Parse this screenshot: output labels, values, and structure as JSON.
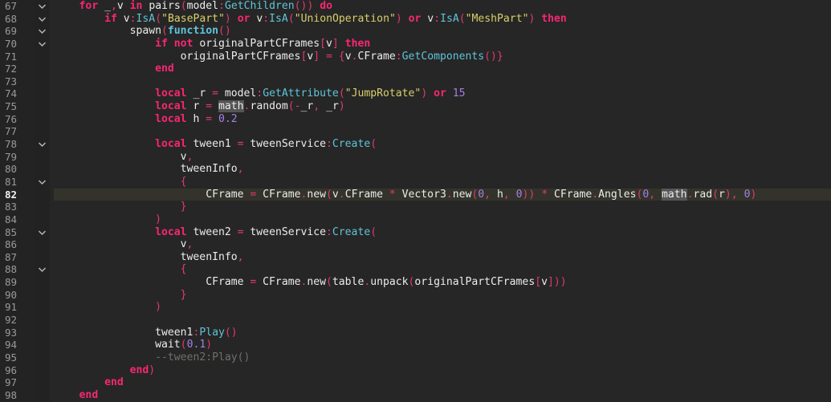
{
  "editor": {
    "current_line": 82,
    "colors": {
      "background": "#262626",
      "keyword": "#f92672",
      "method": "#5fc4da",
      "string": "#d8cf6a",
      "number": "#a77ee6",
      "comment": "#6f6f6a"
    },
    "fold_icon": "chevron-down-icon",
    "lines": [
      {
        "n": "67",
        "fold": true,
        "tokens": [
          [
            "t",
            "    "
          ],
          [
            "k",
            "for"
          ],
          [
            "t",
            " _"
          ],
          [
            "p",
            ","
          ],
          [
            "t",
            "v "
          ],
          [
            "k",
            "in"
          ],
          [
            "t",
            " pairs"
          ],
          [
            "p",
            "("
          ],
          [
            "t",
            "model"
          ],
          [
            "p",
            ":"
          ],
          [
            "f",
            "GetChildren"
          ],
          [
            "p",
            "())"
          ],
          [
            "t",
            " "
          ],
          [
            "k",
            "do"
          ]
        ]
      },
      {
        "n": "68",
        "fold": true,
        "tokens": [
          [
            "t",
            "        "
          ],
          [
            "k",
            "if"
          ],
          [
            "t",
            " v"
          ],
          [
            "p",
            ":"
          ],
          [
            "f",
            "IsA"
          ],
          [
            "p",
            "("
          ],
          [
            "s",
            "\"BasePart\""
          ],
          [
            "p",
            ")"
          ],
          [
            "t",
            " "
          ],
          [
            "k",
            "or"
          ],
          [
            "t",
            " v"
          ],
          [
            "p",
            ":"
          ],
          [
            "f",
            "IsA"
          ],
          [
            "p",
            "("
          ],
          [
            "s",
            "\"UnionOperation\""
          ],
          [
            "p",
            ")"
          ],
          [
            "t",
            " "
          ],
          [
            "k",
            "or"
          ],
          [
            "t",
            " v"
          ],
          [
            "p",
            ":"
          ],
          [
            "f",
            "IsA"
          ],
          [
            "p",
            "("
          ],
          [
            "s",
            "\"MeshPart\""
          ],
          [
            "p",
            ")"
          ],
          [
            "t",
            " "
          ],
          [
            "k",
            "then"
          ]
        ]
      },
      {
        "n": "69",
        "fold": true,
        "tokens": [
          [
            "t",
            "            spawn"
          ],
          [
            "p",
            "("
          ],
          [
            "fb",
            "function"
          ],
          [
            "p",
            "()"
          ]
        ]
      },
      {
        "n": "70",
        "fold": true,
        "tokens": [
          [
            "t",
            "                "
          ],
          [
            "k",
            "if not"
          ],
          [
            "t",
            " originalPartCFrames"
          ],
          [
            "p",
            "["
          ],
          [
            "t",
            "v"
          ],
          [
            "p",
            "]"
          ],
          [
            "t",
            " "
          ],
          [
            "k",
            "then"
          ]
        ]
      },
      {
        "n": "71",
        "fold": false,
        "tokens": [
          [
            "t",
            "                    originalPartCFrames"
          ],
          [
            "p",
            "["
          ],
          [
            "t",
            "v"
          ],
          [
            "p",
            "]"
          ],
          [
            "t",
            " "
          ],
          [
            "p",
            "="
          ],
          [
            "t",
            " "
          ],
          [
            "p",
            "{"
          ],
          [
            "t",
            "v"
          ],
          [
            "p",
            "."
          ],
          [
            "t",
            "CFrame"
          ],
          [
            "p",
            ":"
          ],
          [
            "f",
            "GetComponents"
          ],
          [
            "p",
            "()}"
          ]
        ]
      },
      {
        "n": "72",
        "fold": false,
        "tokens": [
          [
            "t",
            "                "
          ],
          [
            "k",
            "end"
          ]
        ]
      },
      {
        "n": "73",
        "fold": false,
        "tokens": []
      },
      {
        "n": "74",
        "fold": false,
        "tokens": [
          [
            "t",
            "                "
          ],
          [
            "k",
            "local"
          ],
          [
            "t",
            " _r "
          ],
          [
            "p",
            "="
          ],
          [
            "t",
            " model"
          ],
          [
            "p",
            ":"
          ],
          [
            "f",
            "GetAttribute"
          ],
          [
            "p",
            "("
          ],
          [
            "s",
            "\"JumpRotate\""
          ],
          [
            "p",
            ")"
          ],
          [
            "t",
            " "
          ],
          [
            "k",
            "or"
          ],
          [
            "t",
            " "
          ],
          [
            "n",
            "15"
          ]
        ]
      },
      {
        "n": "75",
        "fold": false,
        "tokens": [
          [
            "t",
            "                "
          ],
          [
            "k",
            "local"
          ],
          [
            "t",
            " r "
          ],
          [
            "p",
            "="
          ],
          [
            "t",
            " "
          ],
          [
            "h",
            "math"
          ],
          [
            "p",
            "."
          ],
          [
            "t",
            "random"
          ],
          [
            "p",
            "(-"
          ],
          [
            "t",
            "_r"
          ],
          [
            "p",
            ","
          ],
          [
            "t",
            " _r"
          ],
          [
            "p",
            ")"
          ]
        ]
      },
      {
        "n": "76",
        "fold": false,
        "tokens": [
          [
            "t",
            "                "
          ],
          [
            "k",
            "local"
          ],
          [
            "t",
            " h "
          ],
          [
            "p",
            "="
          ],
          [
            "t",
            " "
          ],
          [
            "n",
            "0.2"
          ]
        ]
      },
      {
        "n": "77",
        "fold": false,
        "tokens": []
      },
      {
        "n": "78",
        "fold": true,
        "tokens": [
          [
            "t",
            "                "
          ],
          [
            "k",
            "local"
          ],
          [
            "t",
            " tween1 "
          ],
          [
            "p",
            "="
          ],
          [
            "t",
            " tweenService"
          ],
          [
            "p",
            ":"
          ],
          [
            "f",
            "Create"
          ],
          [
            "p",
            "("
          ]
        ]
      },
      {
        "n": "79",
        "fold": false,
        "tokens": [
          [
            "t",
            "                    v"
          ],
          [
            "p",
            ","
          ]
        ]
      },
      {
        "n": "80",
        "fold": false,
        "tokens": [
          [
            "t",
            "                    tweenInfo"
          ],
          [
            "p",
            ","
          ]
        ]
      },
      {
        "n": "81",
        "fold": true,
        "tokens": [
          [
            "t",
            "                    "
          ],
          [
            "p",
            "{"
          ]
        ]
      },
      {
        "n": "82",
        "fold": false,
        "tokens": [
          [
            "t",
            "                        CFrame "
          ],
          [
            "p",
            "="
          ],
          [
            "t",
            " CFrame"
          ],
          [
            "p",
            "."
          ],
          [
            "t",
            "new"
          ],
          [
            "p",
            "("
          ],
          [
            "t",
            "v"
          ],
          [
            "p",
            "."
          ],
          [
            "t",
            "CFrame "
          ],
          [
            "p",
            "*"
          ],
          [
            "t",
            " Vector3"
          ],
          [
            "p",
            "."
          ],
          [
            "t",
            "new"
          ],
          [
            "p",
            "("
          ],
          [
            "n",
            "0"
          ],
          [
            "p",
            ","
          ],
          [
            "t",
            " h"
          ],
          [
            "p",
            ","
          ],
          [
            "t",
            " "
          ],
          [
            "n",
            "0"
          ],
          [
            "p",
            "))"
          ],
          [
            "t",
            " "
          ],
          [
            "p",
            "*"
          ],
          [
            "t",
            " CFrame"
          ],
          [
            "p",
            "."
          ],
          [
            "t",
            "Angles"
          ],
          [
            "p",
            "("
          ],
          [
            "n",
            "0"
          ],
          [
            "p",
            ","
          ],
          [
            "t",
            " "
          ],
          [
            "h",
            "math"
          ],
          [
            "p",
            "."
          ],
          [
            "t",
            "rad"
          ],
          [
            "p",
            "("
          ],
          [
            "t",
            "r"
          ],
          [
            "p",
            "),"
          ],
          [
            "t",
            " "
          ],
          [
            "n",
            "0"
          ],
          [
            "p",
            ")"
          ]
        ]
      },
      {
        "n": "83",
        "fold": false,
        "tokens": [
          [
            "t",
            "                    "
          ],
          [
            "p",
            "}"
          ]
        ]
      },
      {
        "n": "84",
        "fold": false,
        "tokens": [
          [
            "t",
            "                "
          ],
          [
            "p",
            ")"
          ]
        ]
      },
      {
        "n": "85",
        "fold": true,
        "tokens": [
          [
            "t",
            "                "
          ],
          [
            "k",
            "local"
          ],
          [
            "t",
            " tween2 "
          ],
          [
            "p",
            "="
          ],
          [
            "t",
            " tweenService"
          ],
          [
            "p",
            ":"
          ],
          [
            "f",
            "Create"
          ],
          [
            "p",
            "("
          ]
        ]
      },
      {
        "n": "86",
        "fold": false,
        "tokens": [
          [
            "t",
            "                    v"
          ],
          [
            "p",
            ","
          ]
        ]
      },
      {
        "n": "87",
        "fold": false,
        "tokens": [
          [
            "t",
            "                    tweenInfo"
          ],
          [
            "p",
            ","
          ]
        ]
      },
      {
        "n": "88",
        "fold": true,
        "tokens": [
          [
            "t",
            "                    "
          ],
          [
            "p",
            "{"
          ]
        ]
      },
      {
        "n": "89",
        "fold": false,
        "tokens": [
          [
            "t",
            "                        CFrame "
          ],
          [
            "p",
            "="
          ],
          [
            "t",
            " CFrame"
          ],
          [
            "p",
            "."
          ],
          [
            "t",
            "new"
          ],
          [
            "p",
            "("
          ],
          [
            "t",
            "table"
          ],
          [
            "p",
            "."
          ],
          [
            "t",
            "unpack"
          ],
          [
            "p",
            "("
          ],
          [
            "t",
            "originalPartCFrames"
          ],
          [
            "p",
            "["
          ],
          [
            "t",
            "v"
          ],
          [
            "p",
            "]))"
          ]
        ]
      },
      {
        "n": "90",
        "fold": false,
        "tokens": [
          [
            "t",
            "                    "
          ],
          [
            "p",
            "}"
          ]
        ]
      },
      {
        "n": "91",
        "fold": false,
        "tokens": [
          [
            "t",
            "                "
          ],
          [
            "p",
            ")"
          ]
        ]
      },
      {
        "n": "92",
        "fold": false,
        "tokens": []
      },
      {
        "n": "93",
        "fold": false,
        "tokens": [
          [
            "t",
            "                tween1"
          ],
          [
            "p",
            ":"
          ],
          [
            "f",
            "Play"
          ],
          [
            "p",
            "()"
          ]
        ]
      },
      {
        "n": "94",
        "fold": false,
        "tokens": [
          [
            "t",
            "                wait"
          ],
          [
            "p",
            "("
          ],
          [
            "n",
            "0.1"
          ],
          [
            "p",
            ")"
          ]
        ]
      },
      {
        "n": "95",
        "fold": false,
        "tokens": [
          [
            "t",
            "                "
          ],
          [
            "c",
            "--tween2:Play()"
          ]
        ]
      },
      {
        "n": "96",
        "fold": false,
        "tokens": [
          [
            "t",
            "            "
          ],
          [
            "k",
            "end"
          ],
          [
            "p",
            ")"
          ]
        ]
      },
      {
        "n": "97",
        "fold": false,
        "tokens": [
          [
            "t",
            "        "
          ],
          [
            "k",
            "end"
          ]
        ]
      },
      {
        "n": "98",
        "fold": false,
        "tokens": [
          [
            "t",
            "    "
          ],
          [
            "k",
            "end"
          ]
        ]
      }
    ]
  }
}
